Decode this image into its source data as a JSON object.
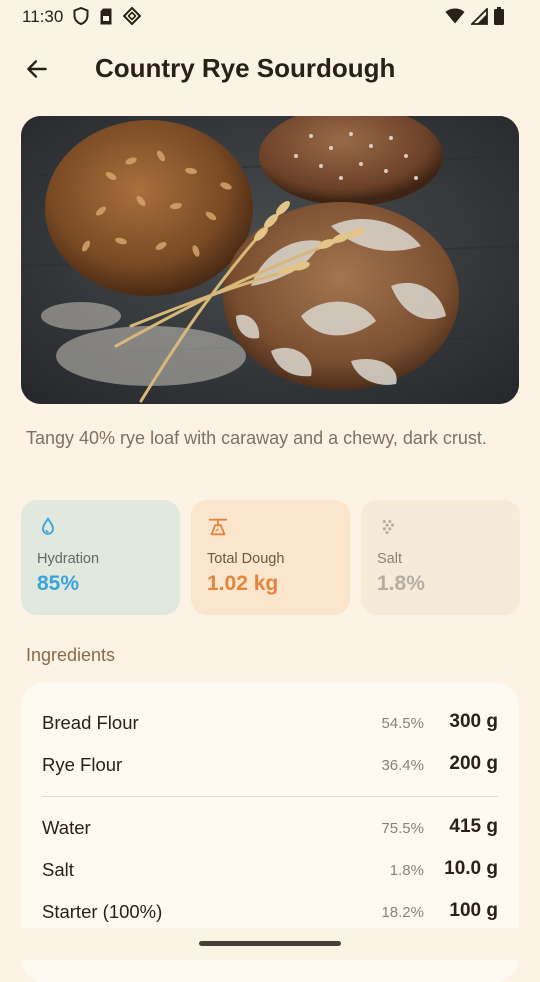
{
  "status_bar": {
    "time": "11:30",
    "left_icons": [
      "shield-icon",
      "sim-card-icon",
      "diamond-app-icon"
    ],
    "right_icons": [
      "wifi-icon",
      "signal-icon",
      "battery-icon"
    ]
  },
  "app_bar": {
    "back_icon": "arrow-left-icon",
    "title": "Country Rye Sourdough"
  },
  "hero_image": {
    "subject": "bread-loaves-with-wheat-photo"
  },
  "description": "Tangy 40% rye loaf with caraway and a chewy, dark crust.",
  "stats": [
    {
      "icon": "water-drop-icon",
      "label": "Hydration",
      "value": "85%",
      "bg": "#e1e9df",
      "label_color": "#5f6a62",
      "value_color": "#3aa3dc",
      "icon_color": "#3aa3dc"
    },
    {
      "icon": "scale-icon",
      "label": "Total Dough",
      "value": "1.02 kg",
      "bg": "#fbe5cc",
      "label_color": "#6b5a48",
      "value_color": "#e2853e",
      "icon_color": "#e2853e"
    },
    {
      "icon": "salt-grains-icon",
      "label": "Salt",
      "value": "1.8%",
      "bg": "#f6ead8",
      "label_color": "#8d8379",
      "value_color": "#b6ada3",
      "icon_color": "#b6ada3"
    }
  ],
  "ingredients": {
    "title": "Ingredients",
    "flours": [
      {
        "name": "Bread Flour",
        "percent": "54.5%",
        "weight": "300 g"
      },
      {
        "name": "Rye Flour",
        "percent": "36.4%",
        "weight": "200 g"
      }
    ],
    "others": [
      {
        "name": "Water",
        "percent": "75.5%",
        "weight": "415 g"
      },
      {
        "name": "Salt",
        "percent": "1.8%",
        "weight": "10.0 g"
      },
      {
        "name": "Starter (100%)",
        "percent": "18.2%",
        "weight": "100 g"
      }
    ]
  },
  "colors": {
    "background": "#fdf3e5",
    "accent_brown": "#8a6a48"
  }
}
